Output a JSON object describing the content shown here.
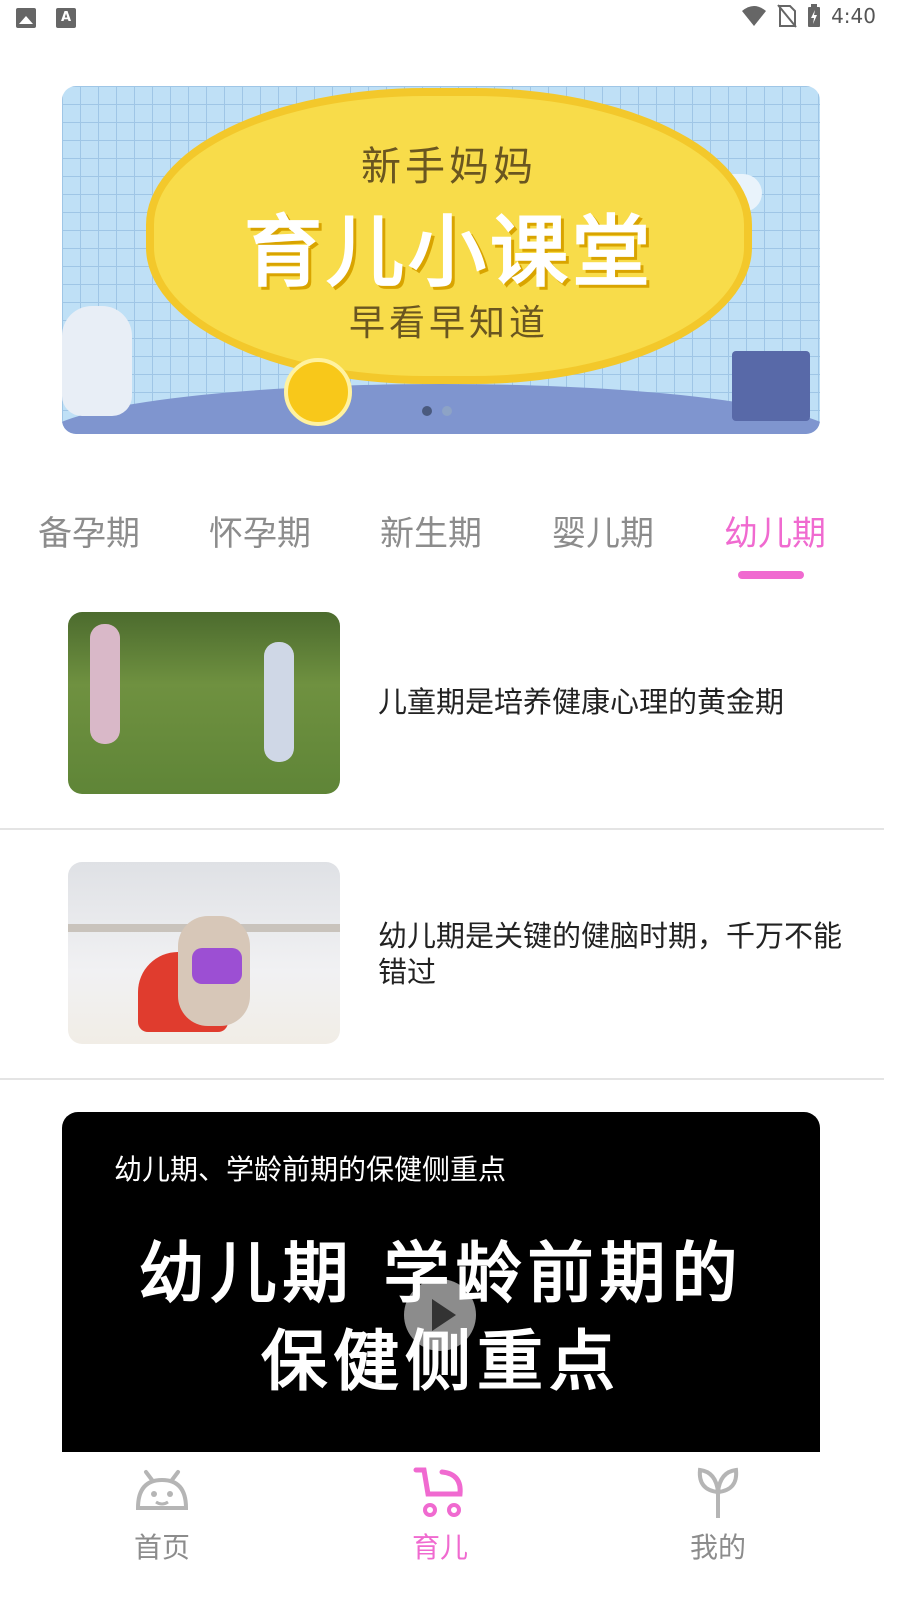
{
  "status_bar": {
    "time": "4:40",
    "left_icons": [
      "image-icon",
      "font-icon"
    ],
    "right_icons": [
      "wifi-icon",
      "no-sim-icon",
      "battery-charging-icon"
    ]
  },
  "banner": {
    "subtitle_top": "新手妈妈",
    "title": "育儿小课堂",
    "subtitle_bottom": "早看早知道",
    "page_count": 2,
    "active_page": 1
  },
  "tabs": [
    {
      "label": "备孕期",
      "active": false
    },
    {
      "label": "怀孕期",
      "active": false
    },
    {
      "label": "新生期",
      "active": false
    },
    {
      "label": "婴儿期",
      "active": false
    },
    {
      "label": "幼儿期",
      "active": true
    }
  ],
  "articles": [
    {
      "title": "儿童期是培养健康心理的黄金期"
    },
    {
      "title": "幼儿期是关键的健脑时期，千万不能错过"
    }
  ],
  "video": {
    "caption": "幼儿期、学龄前期的保健侧重点",
    "overlay_line1": "幼儿期 学龄前期的",
    "overlay_line2": "保健侧重点"
  },
  "bottom_nav": [
    {
      "label": "首页",
      "icon": "cartoon-face-icon",
      "active": false
    },
    {
      "label": "育儿",
      "icon": "stroller-icon",
      "active": true
    },
    {
      "label": "我的",
      "icon": "sprout-icon",
      "active": false
    }
  ],
  "colors": {
    "accent": "#f06ad0",
    "tab_inactive": "#8c8c8c",
    "divider": "#e4e4e4"
  }
}
